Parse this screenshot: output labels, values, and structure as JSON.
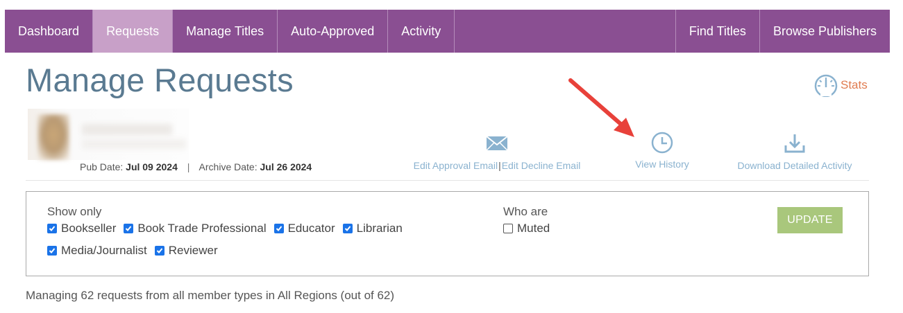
{
  "nav": {
    "left": [
      "Dashboard",
      "Requests",
      "Manage Titles",
      "Auto-Approved",
      "Activity"
    ],
    "right": [
      "Find Titles",
      "Browse Publishers"
    ],
    "active": "Requests"
  },
  "page": {
    "title": "Manage Requests",
    "stats_label": "Stats"
  },
  "book": {
    "pub_date_label": "Pub Date:",
    "pub_date": "Jul 09 2024",
    "separator": "|",
    "archive_date_label": "Archive Date:",
    "archive_date": "Jul 26 2024"
  },
  "actions": {
    "edit_approval": "Edit Approval Email",
    "pipe": "|",
    "edit_decline": "Edit Decline Email",
    "view_history": "View History",
    "download": "Download Detailed Activity"
  },
  "filters": {
    "show_only_label": "Show only",
    "types": [
      {
        "label": "Bookseller",
        "checked": true
      },
      {
        "label": "Book Trade Professional",
        "checked": true
      },
      {
        "label": "Educator",
        "checked": true
      },
      {
        "label": "Librarian",
        "checked": true
      },
      {
        "label": "Media/Journalist",
        "checked": true
      },
      {
        "label": "Reviewer",
        "checked": true
      }
    ],
    "who_are_label": "Who are",
    "muted": {
      "label": "Muted",
      "checked": false
    },
    "update_label": "UPDATE"
  },
  "summary": "Managing 62 requests from all member types in All Regions (out of 62)",
  "colors": {
    "nav_bg": "#8a4f92",
    "nav_active": "#c8a0c8",
    "title": "#5a7a91",
    "link": "#8ab2cf",
    "stats": "#e07b4f",
    "update_btn": "#a9c77c",
    "arrow": "#e8413a"
  }
}
